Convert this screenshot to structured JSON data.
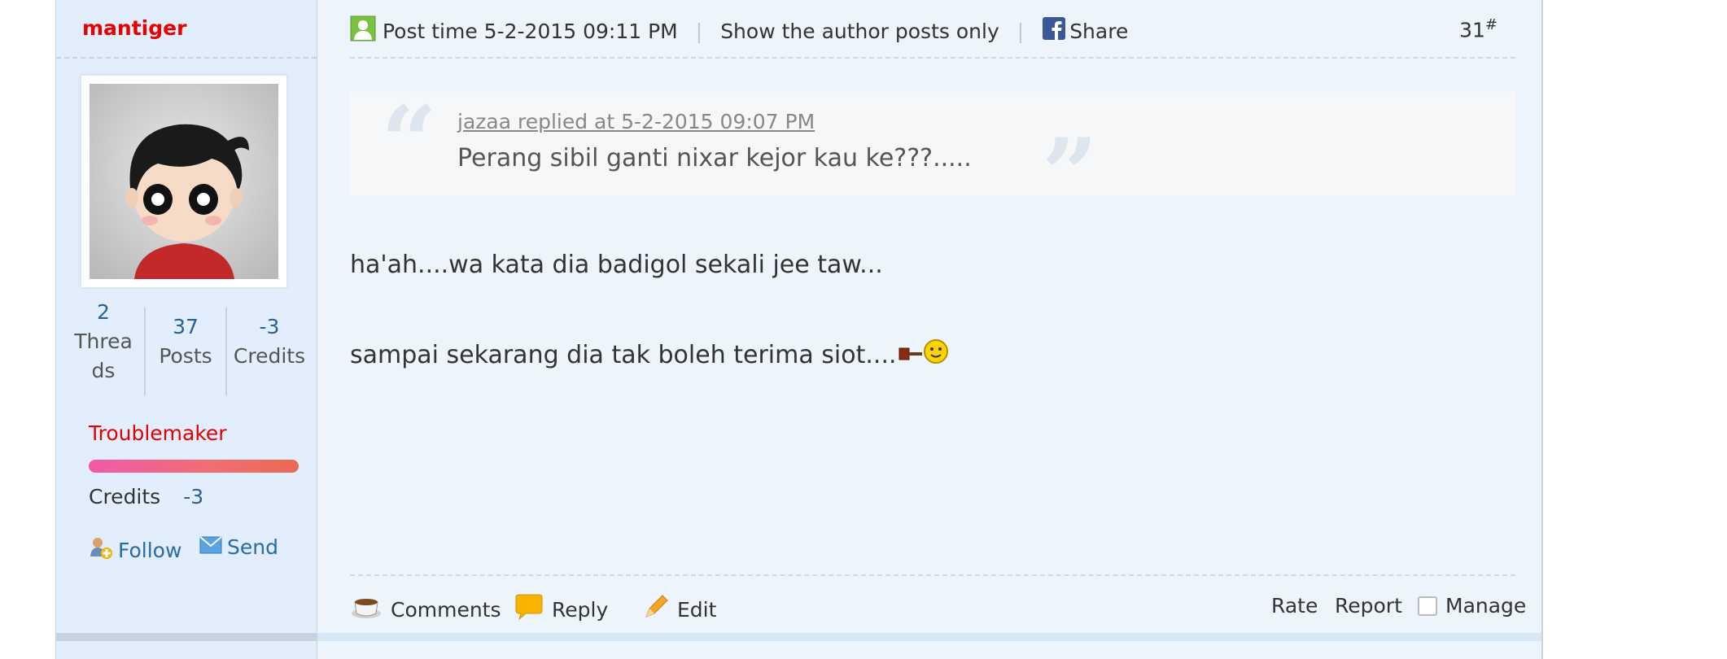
{
  "author": {
    "username": "mantiger",
    "stats": [
      {
        "value": "2",
        "label": "Threads"
      },
      {
        "value": "37",
        "label": "Posts"
      },
      {
        "value": "-3",
        "label": "Credits"
      }
    ],
    "group": "Troublemaker",
    "credits_label": "Credits",
    "credits_value": "-3",
    "follow_label": "Follow",
    "send_label": "Send"
  },
  "post": {
    "post_time": "Post time 5-2-2015 09:11 PM",
    "author_only": "Show the author posts only",
    "share": "Share",
    "floor": "31",
    "floor_mark": "#",
    "quote": {
      "author_line": "jazaa replied at 5-2-2015 09:07 PM",
      "text": "Perang sibil ganti nixar kejor kau ke???....."
    },
    "body": [
      "ha'ah....wa kata dia badigol sekali jee taw...",
      "sampai sekarang dia tak boleh terima siot...."
    ]
  },
  "actions": {
    "comments": "Comments",
    "reply": "Reply",
    "edit": "Edit",
    "rate": "Rate",
    "report": "Report",
    "manage": "Manage"
  },
  "colors": {
    "username": "#e60000",
    "link": "#2b6aa5",
    "sidebar_bg": "#e2eefb",
    "post_bg": "#edf4fc"
  }
}
